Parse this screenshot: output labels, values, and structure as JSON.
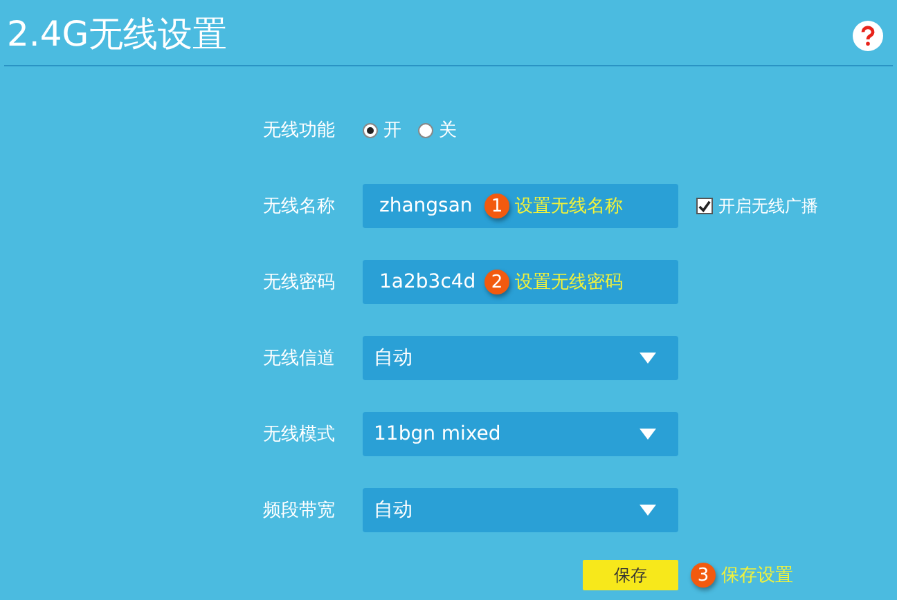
{
  "title": "2.4G无线设置",
  "rows": [
    {
      "kind": "radio",
      "label": "无线功能",
      "options": [
        {
          "label": "开",
          "selected": true
        },
        {
          "label": "关",
          "selected": false
        }
      ]
    },
    {
      "kind": "text",
      "label": "无线名称",
      "value": "zhangsan",
      "note": {
        "number": "1",
        "text": "设置无线名称"
      },
      "checkbox": {
        "label": "开启无线广播",
        "checked": true
      }
    },
    {
      "kind": "text",
      "label": "无线密码",
      "value": "1a2b3c4d",
      "note": {
        "number": "2",
        "text": "设置无线密码"
      }
    },
    {
      "kind": "select",
      "label": "无线信道",
      "value": "自动"
    },
    {
      "kind": "select",
      "label": "无线模式",
      "value": "11bgn mixed"
    },
    {
      "kind": "select",
      "label": "频段带宽",
      "value": "自动"
    }
  ],
  "save": {
    "label": "保存",
    "note": {
      "number": "3",
      "text": "保存设置"
    }
  }
}
